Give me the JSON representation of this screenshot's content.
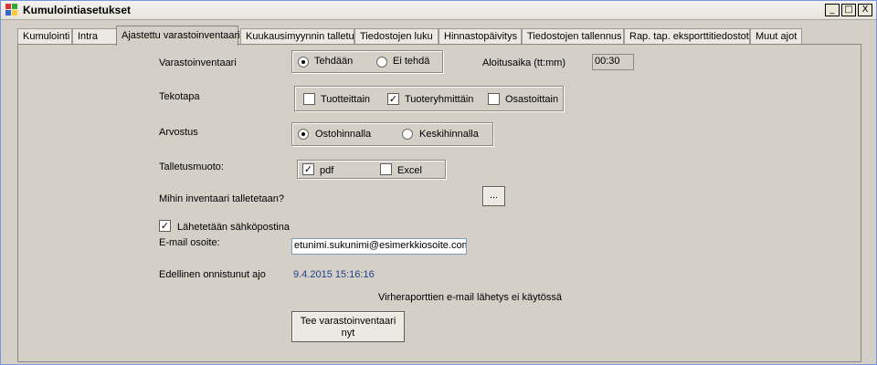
{
  "window": {
    "title": "Kumulointiasetukset"
  },
  "window_controls": [
    "_",
    "□",
    "X"
  ],
  "tabs": [
    {
      "label": "Kumulointi"
    },
    {
      "label": "Intra"
    },
    {
      "label": "Ajastettu varastoinventaari"
    },
    {
      "label": "Kuukausimyynnin talletus"
    },
    {
      "label": "Tiedostojen luku"
    },
    {
      "label": "Hinnastopäivitys"
    },
    {
      "label": "Tiedostojen tallennus"
    },
    {
      "label": "Rap. tap. eksporttitiedostot"
    },
    {
      "label": "Muut ajot"
    }
  ],
  "active_tab": "Ajastettu varastoinventaari",
  "form": {
    "varasto_label": "Varastoinventaari",
    "varasto_yes": "Tehdään",
    "varasto_no": "Ei tehdä",
    "varasto_selected": "Tehdään",
    "start_label": "Aloitusaika (tt:mm)",
    "start_value": "00:30",
    "tekotapa_label": "Tekotapa",
    "tekotapa_options": [
      {
        "label": "Tuotteittain",
        "checked": false
      },
      {
        "label": "Tuoteryhmittäin",
        "checked": true
      },
      {
        "label": "Osastoittain",
        "checked": false
      }
    ],
    "arvostus_label": "Arvostus",
    "arvostus_opt1": "Ostohinnalla",
    "arvostus_opt2": "Keskihinnalla",
    "arvostus_selected": "Ostohinnalla",
    "talletus_label": "Talletusmuoto:",
    "talletus_options": [
      {
        "label": "pdf",
        "checked": true
      },
      {
        "label": "Excel",
        "checked": false
      }
    ],
    "path_label": "Mihin inventaari talletetaan?",
    "browse_button": "...",
    "email_check_label": "Lähetetään sähköpostina",
    "email_check_checked": true,
    "email_label": "E-mail osoite:",
    "email_value": "etunimi.sukunimi@esimerkkiosoite.com",
    "last_run_label": "Edellinen onnistunut ajo",
    "last_run_value": "9.4.2015 15:16:16",
    "error_mail_note": "Virheraporttien e-mail lähetys ei käytössä",
    "run_button_line1": "Tee varastoinventaari",
    "run_button_line2": "nyt"
  }
}
